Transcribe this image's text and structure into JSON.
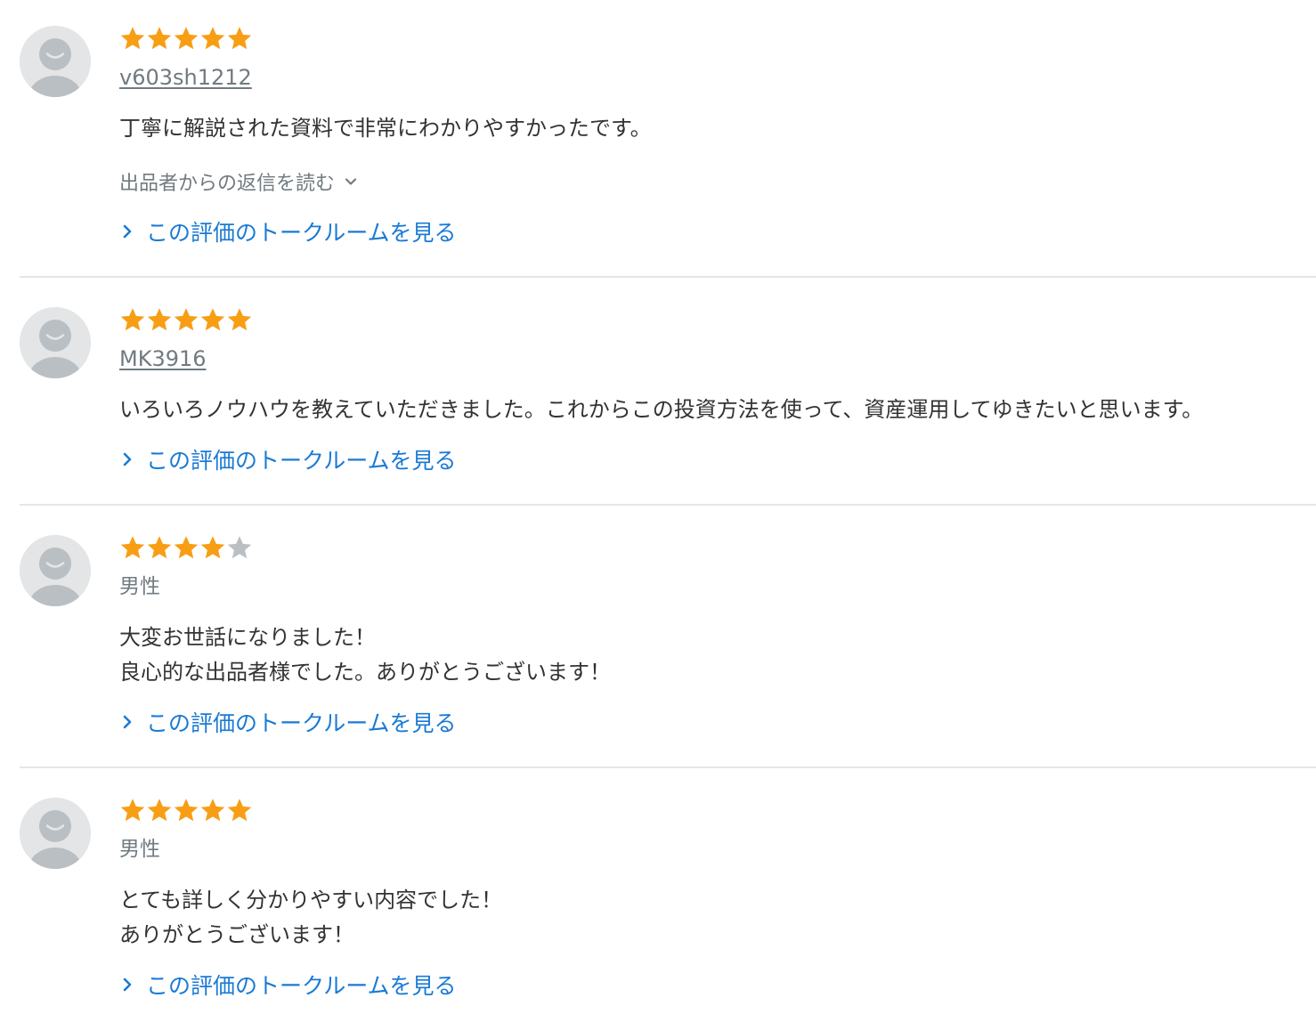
{
  "colors": {
    "star_filled": "#f89e15",
    "star_empty": "#b9bfc3",
    "link": "#1a7ad4",
    "muted": "#707b80",
    "divider": "#e6e6e6"
  },
  "reviews": [
    {
      "rating": 5,
      "user": "v603sh1212",
      "comment": "丁寧に解説された資料で非常にわかりやすかったです。",
      "reply_toggle": "出品者からの返信を読む",
      "talk_link": "この評価のトークルームを見る"
    },
    {
      "rating": 5,
      "user": "MK3916",
      "comment": "いろいろノウハウを教えていただきました。これからこの投資方法を使って、資産運用してゆきたいと思います。",
      "talk_link": "この評価のトークルームを見る"
    },
    {
      "rating": 4,
      "user": "男性",
      "comment_line1": "大変お世話になりました！",
      "comment_line2": "良心的な出品者様でした。ありがとうございます！",
      "talk_link": "この評価のトークルームを見る"
    },
    {
      "rating": 5,
      "user": "男性",
      "comment_line1": "とても詳しく分かりやすい内容でした！",
      "comment_line2": "ありがとうございます！",
      "talk_link": "この評価のトークルームを見る"
    }
  ]
}
